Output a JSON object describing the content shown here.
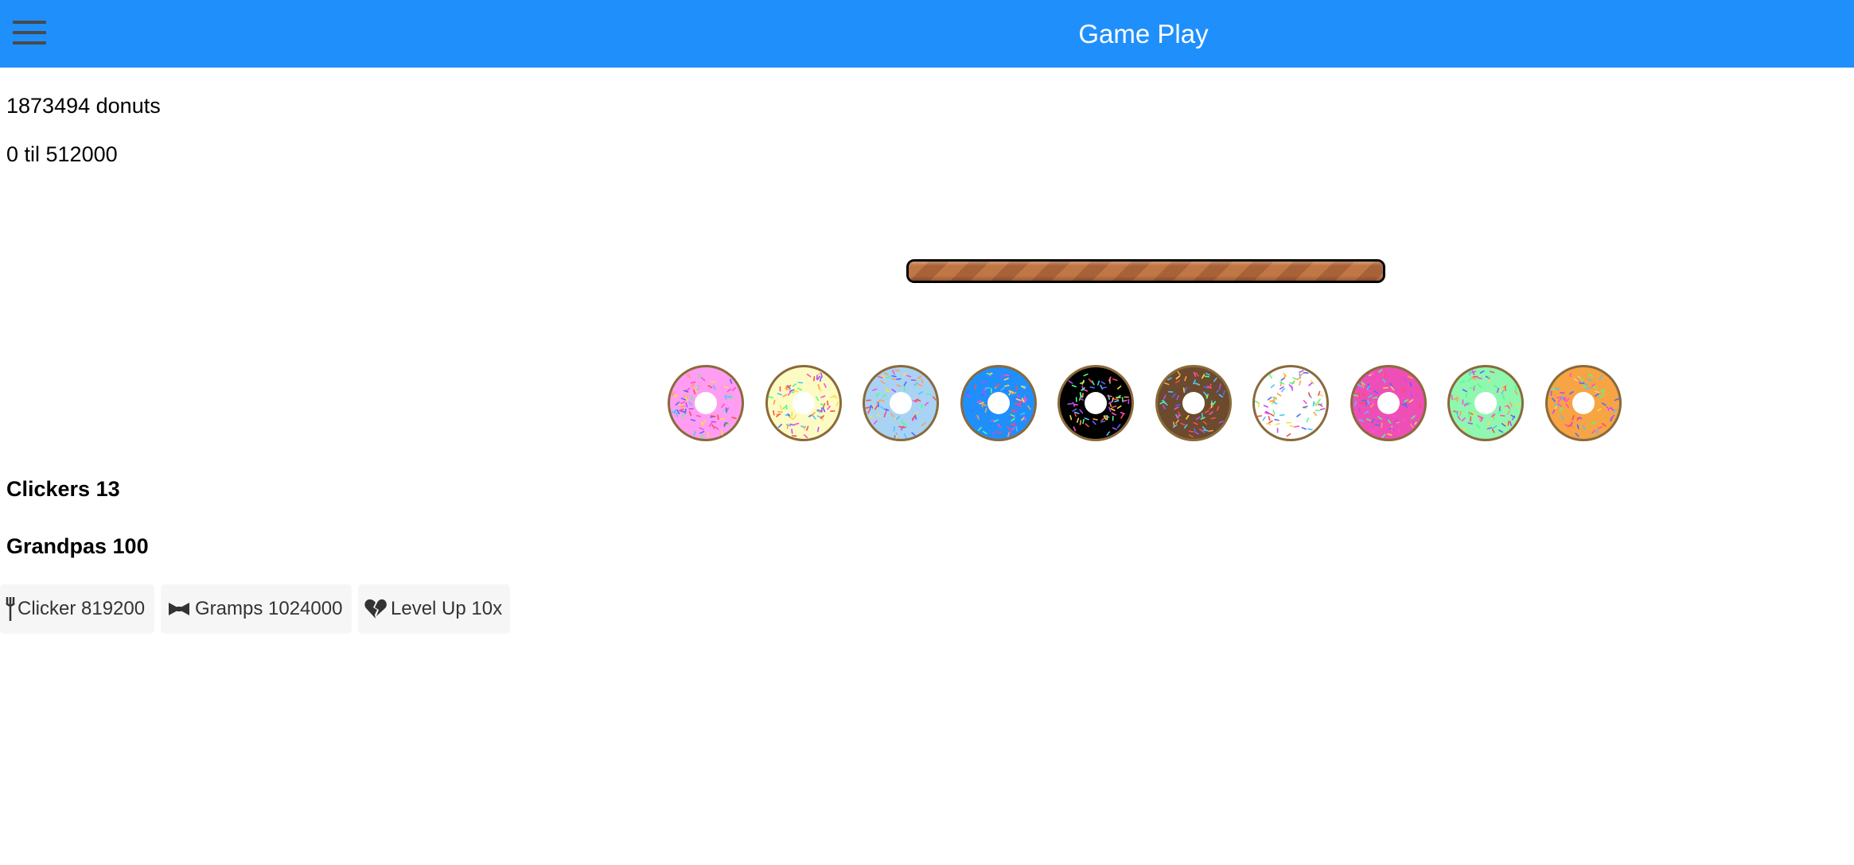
{
  "header": {
    "title": "Game Play",
    "menu_icon": "hamburger-menu-icon",
    "background_color": "#1f8ffc"
  },
  "stats": {
    "donut_count": "1873494",
    "donut_unit": "donuts",
    "progress_text": "0 til 512000",
    "clickers": "Clickers 13",
    "grandpas": "Grandpas 100"
  },
  "progress": {
    "fraction": 1.0,
    "fill_color": "#b46a3e"
  },
  "donuts": [
    {
      "name": "pink",
      "color": "#ff9df2"
    },
    {
      "name": "vanilla",
      "color": "#fdfbc4"
    },
    {
      "name": "light-blue",
      "color": "#a8d3f5"
    },
    {
      "name": "blue",
      "color": "#1f8ffc"
    },
    {
      "name": "black",
      "color": "#000000"
    },
    {
      "name": "chocolate",
      "color": "#6b4a2e"
    },
    {
      "name": "white",
      "color": "#ffffff"
    },
    {
      "name": "magenta",
      "color": "#ee4fb6"
    },
    {
      "name": "mint",
      "color": "#8ff7b0"
    },
    {
      "name": "orange",
      "color": "#f7a444"
    }
  ],
  "shop": {
    "clicker_label": "Clicker 819200",
    "clicker_icon": "fork-icon",
    "gramps_label": "Gramps 1024000",
    "gramps_icon": "bowtie-icon",
    "levelup_label": "Level Up 10x",
    "levelup_icon": "broken-heart-icon"
  }
}
